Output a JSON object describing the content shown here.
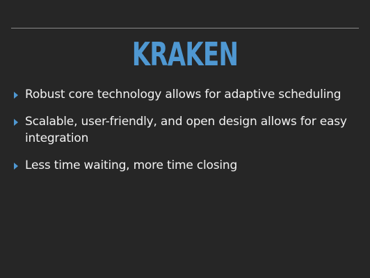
{
  "slide": {
    "title": "KRAKEN",
    "bullets": [
      "Robust core technology allows for adaptive scheduling",
      "Scalable, user-friendly, and open design allows for easy integration",
      "Less time waiting, more time closing"
    ]
  },
  "colors": {
    "background": "#262626",
    "accent": "#4f98d2",
    "text": "#f2f2f2",
    "rule": "#8a8a8a"
  },
  "icons": {
    "bullet": "triangle-right-icon"
  }
}
